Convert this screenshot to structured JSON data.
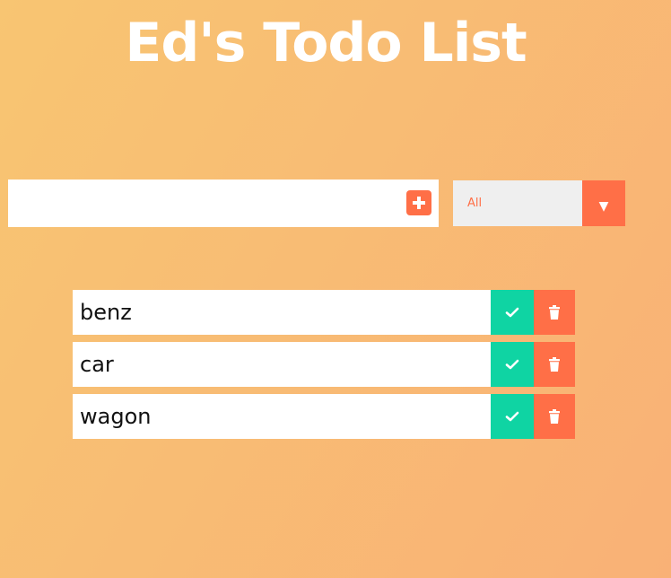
{
  "header": {
    "title": "Ed's Todo List"
  },
  "form": {
    "input_value": "",
    "input_placeholder": "",
    "add_icon": "plus-square-icon",
    "filter": {
      "selected": "All",
      "arrow_icon": "caret-down-icon"
    }
  },
  "todos": [
    {
      "text": "benz"
    },
    {
      "text": "car"
    },
    {
      "text": "wagon"
    }
  ],
  "colors": {
    "background_start": "#f8c572",
    "background_end": "#f9b176",
    "accent": "#ff6f47",
    "complete": "#0fd4a3"
  }
}
